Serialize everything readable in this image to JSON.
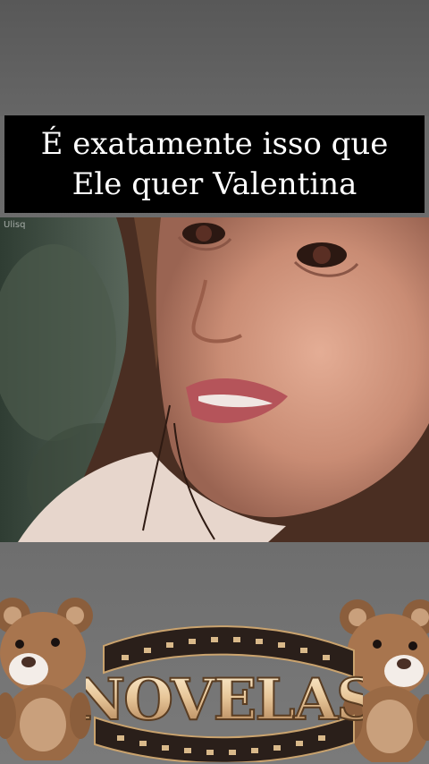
{
  "caption": {
    "line1": "É exatamente isso que",
    "line2": "Ele quer Valentina"
  },
  "watermark": "Ulisq",
  "logo": {
    "text": "NOVELAS"
  },
  "decorations": {
    "left_icon": "teddy-bear-icon",
    "right_icon": "teddy-bear-icon",
    "logo_icon": "film-reel-icon"
  }
}
